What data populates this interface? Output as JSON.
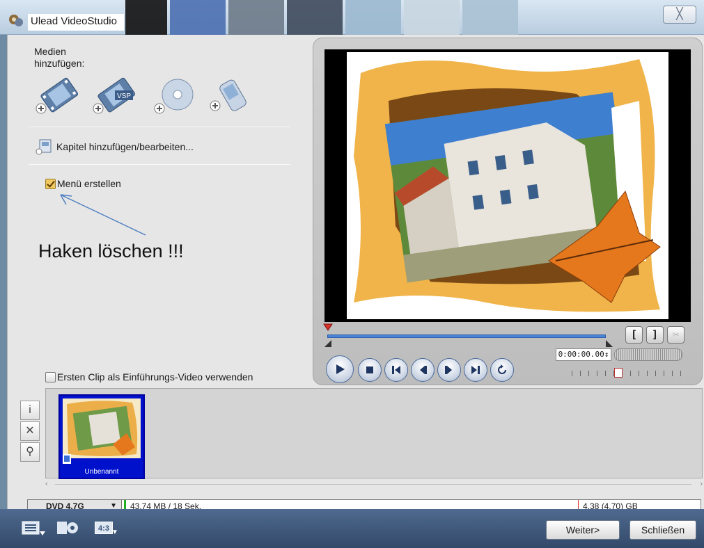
{
  "window": {
    "title": "Ulead VideoStudio",
    "close_label": "╳",
    "close_icon": "close-icon"
  },
  "left": {
    "add_media_label": "Medien hinzufügen:",
    "media_buttons": [
      {
        "icon": "add-video-icon"
      },
      {
        "icon": "add-vsp-project-icon",
        "badge": "VSP"
      },
      {
        "icon": "add-disc-icon"
      },
      {
        "icon": "add-mobile-device-icon"
      }
    ],
    "chapter_label": "Kapitel hinzufügen/bearbeiten...",
    "menu_checkbox_label": "Menü erstellen",
    "menu_checked": true,
    "annotation": "Haken löschen !!!"
  },
  "preview": {
    "timecode": "0:00:00.00↕"
  },
  "intro_checkbox_label": "Ersten Clip als Einführungs-Video verwenden",
  "intro_checked": false,
  "clip": {
    "name": "Unbenannt"
  },
  "status": {
    "disc": "DVD 4.7G",
    "used": "43.74 MB / 18 Sek.",
    "free": "4.38 (4.70) GB"
  },
  "bottom": {
    "aspect_label": "4:3",
    "next_label": "Weiter>",
    "close_label": "Schließen"
  },
  "colors": {
    "accent": "#4a84d8",
    "clip_bg": "#0011cc"
  }
}
